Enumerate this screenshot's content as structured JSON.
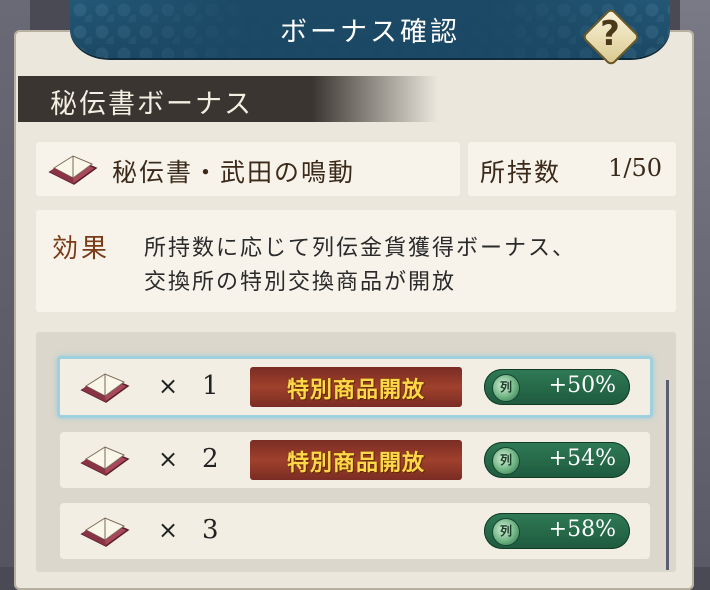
{
  "header": {
    "title": "ボーナス確認",
    "help_symbol": "?"
  },
  "section": {
    "title": "秘伝書ボーナス"
  },
  "book": {
    "name": "秘伝書・武田の鳴動",
    "icon": "book-icon"
  },
  "owned": {
    "label": "所持数",
    "value": "1/50"
  },
  "effect": {
    "label": "効果",
    "line1": "所持数に応じて列伝金貨獲得ボーナス、",
    "line2": "交換所の特別交換商品が開放"
  },
  "bonus_rows": [
    {
      "times": "×",
      "count": "1",
      "special": "特別商品開放",
      "percent": "+50%",
      "selected": true
    },
    {
      "times": "×",
      "count": "2",
      "special": "特別商品開放",
      "percent": "+54%",
      "selected": false
    },
    {
      "times": "×",
      "count": "3",
      "special": "",
      "percent": "+58%",
      "selected": false
    }
  ],
  "coin_glyph": "列",
  "colors": {
    "header_blue": "#1b4864",
    "panel_bg": "#ebe7dd",
    "effect_label": "#7a3c18",
    "badge_gold": "#ffd84a",
    "badge_red": "#7a2c24",
    "pill_green": "#2f7a55",
    "selected_outline": "#9fd0de"
  }
}
